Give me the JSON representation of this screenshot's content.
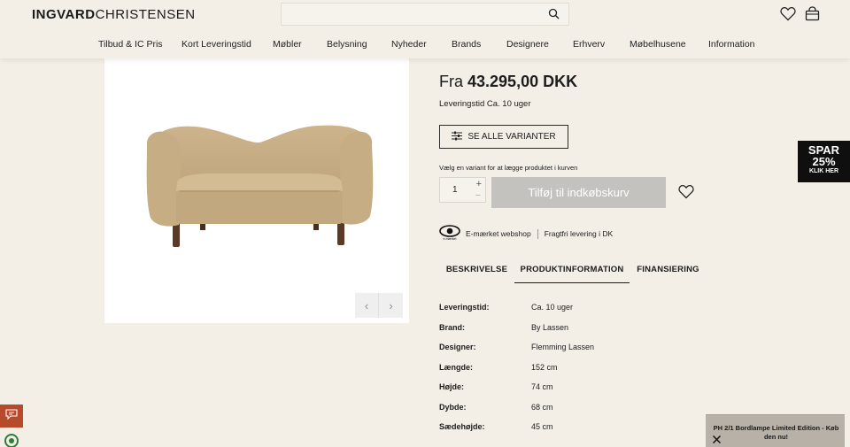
{
  "brand": {
    "logo_bold": "INGVARD",
    "logo_light": "CHRISTENSEN"
  },
  "search": {
    "placeholder": ""
  },
  "nav": [
    "Tilbud & IC Pris",
    "Kort Leveringstid",
    "Møbler",
    "Belysning",
    "Nyheder",
    "Brands",
    "Designere",
    "Erhverv",
    "Møbelhusene",
    "Information"
  ],
  "gallery": {
    "prev": "‹",
    "next": "›"
  },
  "product": {
    "price_prefix": "Fra",
    "price": "43.295,00 DKK",
    "lead_time": "Leveringstid Ca. 10 uger",
    "variants_button": "SE ALLE VARIANTER",
    "variant_hint": "Vælg en variant for at lægge produktet i kurven",
    "quantity": "1",
    "qty_plus": "+",
    "qty_minus": "−",
    "add_to_cart": "Tilføj til indkøbskurv"
  },
  "trust": {
    "emark_label": "E-mærket webshop",
    "shipping": "Fragtfri levering i DK"
  },
  "tabs": [
    "BESKRIVELSE",
    "PRODUKTINFORMATION",
    "FINANSIERING"
  ],
  "active_tab": "PRODUKTINFORMATION",
  "specs": [
    {
      "key": "Leveringstid:",
      "value": "Ca. 10 uger"
    },
    {
      "key": "Brand:",
      "value": "By Lassen"
    },
    {
      "key": "Designer:",
      "value": "Flemming Lassen"
    },
    {
      "key": "Længde:",
      "value": "152 cm"
    },
    {
      "key": "Højde:",
      "value": "74 cm"
    },
    {
      "key": "Dybde:",
      "value": "68 cm"
    },
    {
      "key": "Sædehøjde:",
      "value": "45 cm"
    }
  ],
  "promo": {
    "line1": "SPAR",
    "line2": "25%",
    "line3": "KLIK HER"
  },
  "toast": {
    "text": "PH 2/1 Bordlampe Limited Edition - Køb den nu!"
  },
  "icons": {
    "search": "search-icon",
    "wishlist": "heart-icon",
    "cart": "bag-icon",
    "variants": "sliders-icon",
    "emark": "emark-logo-icon",
    "chat": "chat-icon",
    "close": "close-icon"
  },
  "colors": {
    "background": "#f3eee6",
    "add_to_cart_disabled": "#c4c2bf",
    "promo_bg": "#0f0f0f",
    "chat_bg": "#b84a2c",
    "toast_bg": "#b7b1a7"
  }
}
